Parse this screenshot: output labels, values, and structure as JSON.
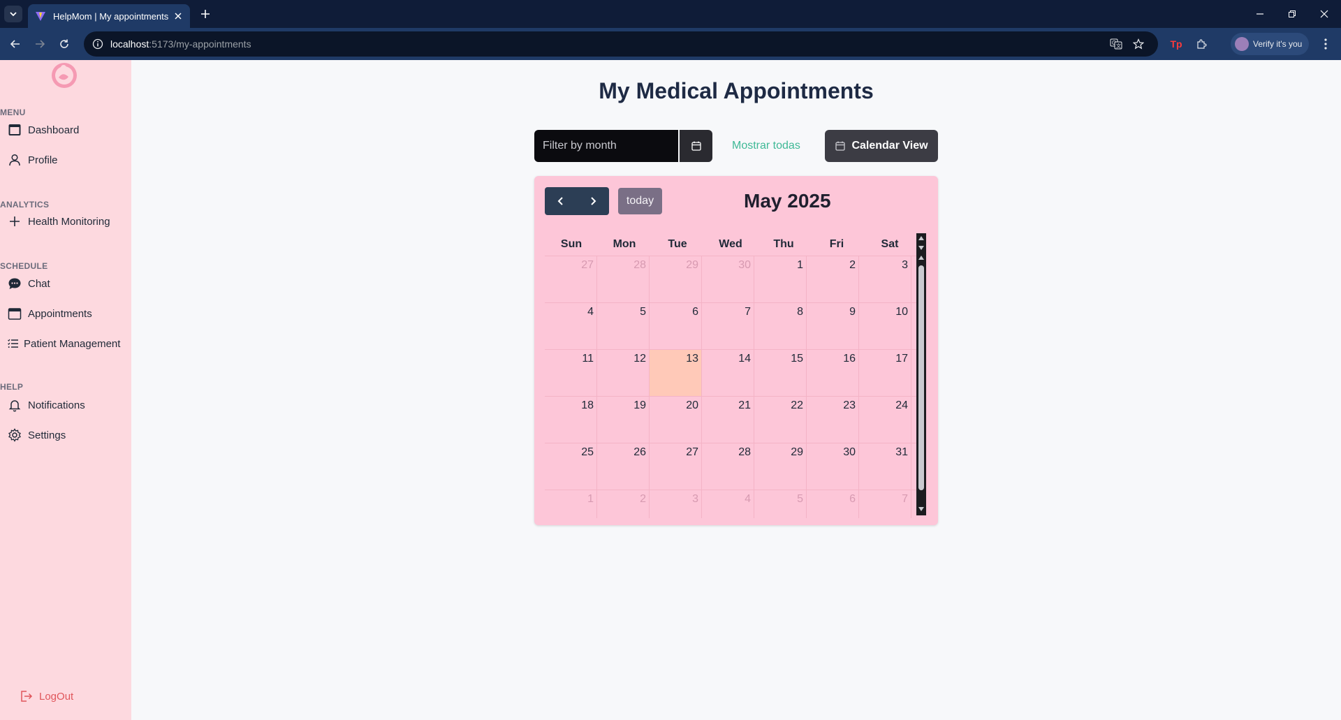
{
  "browser": {
    "tab_title": "HelpMom | My appointments",
    "url_host": "localhost",
    "url_path": ":5173/my-appointments",
    "profile_label": "Verify it's you"
  },
  "sidebar": {
    "sections": {
      "menu": "MENU",
      "analytics": "ANALYTICS",
      "schedule": "SCHEDULE",
      "help": "HELP"
    },
    "items": {
      "dashboard": "Dashboard",
      "profile": "Profile",
      "health": "Health Monitoring",
      "chat": "Chat",
      "appointments": "Appointments",
      "patients": "Patient Management",
      "notifications": "Notifications",
      "settings": "Settings"
    },
    "logout": "LogOut"
  },
  "main": {
    "title": "My Medical Appointments",
    "filter_placeholder": "Filter by month",
    "show_all": "Mostrar todas",
    "calendar_view": "Calendar View"
  },
  "calendar": {
    "today_label": "today",
    "month_title": "May 2025",
    "weekdays": [
      "Sun",
      "Mon",
      "Tue",
      "Wed",
      "Thu",
      "Fri",
      "Sat"
    ],
    "weeks": [
      [
        {
          "d": "27",
          "o": true
        },
        {
          "d": "28",
          "o": true
        },
        {
          "d": "29",
          "o": true
        },
        {
          "d": "30",
          "o": true
        },
        {
          "d": "1"
        },
        {
          "d": "2"
        },
        {
          "d": "3"
        }
      ],
      [
        {
          "d": "4"
        },
        {
          "d": "5"
        },
        {
          "d": "6"
        },
        {
          "d": "7"
        },
        {
          "d": "8"
        },
        {
          "d": "9"
        },
        {
          "d": "10"
        }
      ],
      [
        {
          "d": "11"
        },
        {
          "d": "12"
        },
        {
          "d": "13",
          "t": true
        },
        {
          "d": "14"
        },
        {
          "d": "15"
        },
        {
          "d": "16"
        },
        {
          "d": "17"
        }
      ],
      [
        {
          "d": "18"
        },
        {
          "d": "19"
        },
        {
          "d": "20"
        },
        {
          "d": "21"
        },
        {
          "d": "22"
        },
        {
          "d": "23"
        },
        {
          "d": "24"
        }
      ],
      [
        {
          "d": "25"
        },
        {
          "d": "26"
        },
        {
          "d": "27"
        },
        {
          "d": "28"
        },
        {
          "d": "29"
        },
        {
          "d": "30"
        },
        {
          "d": "31"
        }
      ],
      [
        {
          "d": "1",
          "o": true
        },
        {
          "d": "2",
          "o": true
        },
        {
          "d": "3",
          "o": true
        },
        {
          "d": "4",
          "o": true
        },
        {
          "d": "5",
          "o": true
        },
        {
          "d": "6",
          "o": true
        },
        {
          "d": "7",
          "o": true
        }
      ]
    ]
  },
  "colors": {
    "sidebar_bg": "#fdd9df",
    "calendar_bg": "#fdc6d8",
    "today_highlight": "#ffc9b8",
    "accent_green": "#3fb996",
    "logout_red": "#e0565b"
  }
}
